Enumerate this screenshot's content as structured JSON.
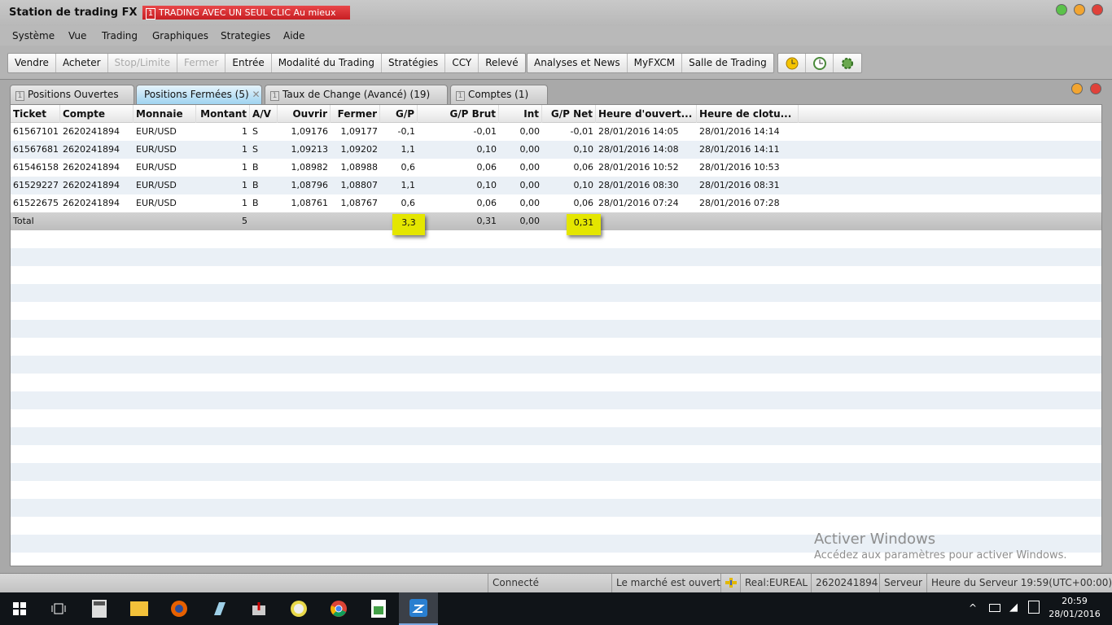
{
  "window": {
    "title": "Station de trading FX",
    "banner_num": "1",
    "banner": "TRADING AVEC UN SEUL CLIC Au mieux"
  },
  "menu": [
    "Système",
    "Vue",
    "Trading",
    "Graphiques",
    "Strategies",
    "Aide"
  ],
  "toolbar": {
    "group1": [
      {
        "label": "Vendre",
        "enabled": true
      },
      {
        "label": "Acheter",
        "enabled": true
      },
      {
        "label": "Stop/Limite",
        "enabled": false
      },
      {
        "label": "Fermer",
        "enabled": false
      },
      {
        "label": "Entrée",
        "enabled": true
      },
      {
        "label": "Modalité du Trading",
        "enabled": true
      },
      {
        "label": "Stratégies",
        "enabled": true
      },
      {
        "label": "CCY",
        "enabled": true
      },
      {
        "label": "Relevé",
        "enabled": true
      }
    ],
    "group2": [
      "Analyses et News",
      "MyFXCM",
      "Salle de Trading"
    ],
    "icons": [
      "clock-icon",
      "clock-refresh-icon",
      "gear-refresh-icon"
    ]
  },
  "tabs": [
    {
      "label": "Positions Ouvertes",
      "num": "1"
    },
    {
      "label": "Positions Fermées (5)",
      "active": true
    },
    {
      "label": "Taux de Change (Avancé) (19)",
      "num": "1"
    },
    {
      "label": "Comptes (1)",
      "num": "1"
    }
  ],
  "table": {
    "columns": [
      "Ticket",
      "Compte",
      "Monnaie",
      "Montant",
      "A/V",
      "Ouvrir",
      "Fermer",
      "G/P",
      "G/P Brut",
      "Int",
      "G/P Net",
      "Heure d'ouvert...",
      "Heure de clotu..."
    ],
    "rows": [
      [
        "61567101",
        "2620241894",
        "EUR/USD",
        "1",
        "S",
        "1,09176",
        "1,09177",
        "-0,1",
        "-0,01",
        "0,00",
        "-0,01",
        "28/01/2016 14:05",
        "28/01/2016 14:14"
      ],
      [
        "61567681",
        "2620241894",
        "EUR/USD",
        "1",
        "S",
        "1,09213",
        "1,09202",
        "1,1",
        "0,10",
        "0,00",
        "0,10",
        "28/01/2016 14:08",
        "28/01/2016 14:11"
      ],
      [
        "61546158",
        "2620241894",
        "EUR/USD",
        "1",
        "B",
        "1,08982",
        "1,08988",
        "0,6",
        "0,06",
        "0,00",
        "0,06",
        "28/01/2016 10:52",
        "28/01/2016 10:53"
      ],
      [
        "61529227",
        "2620241894",
        "EUR/USD",
        "1",
        "B",
        "1,08796",
        "1,08807",
        "1,1",
        "0,10",
        "0,00",
        "0,10",
        "28/01/2016 08:30",
        "28/01/2016 08:31"
      ],
      [
        "61522675",
        "2620241894",
        "EUR/USD",
        "1",
        "B",
        "1,08761",
        "1,08767",
        "0,6",
        "0,06",
        "0,00",
        "0,06",
        "28/01/2016 07:24",
        "28/01/2016 07:28"
      ]
    ],
    "total": {
      "label": "Total",
      "montant": "5",
      "gp": "3,3",
      "gp_brut": "0,31",
      "int": "0,00",
      "gp_net": "0,31"
    },
    "highlight_color": "#e4e600"
  },
  "status": {
    "connection": "Connecté",
    "market": "Le marché est ouvert",
    "account_type": "Real:EUREAL",
    "account": "2620241894",
    "server": "Serveur",
    "server_time": "Heure du Serveur 19:59(UTC+00:00)"
  },
  "watermark": {
    "title": "Activer Windows",
    "subtitle": "Accédez aux paramètres pour activer Windows."
  },
  "taskbar": {
    "time": "20:59",
    "date": "28/01/2016"
  }
}
